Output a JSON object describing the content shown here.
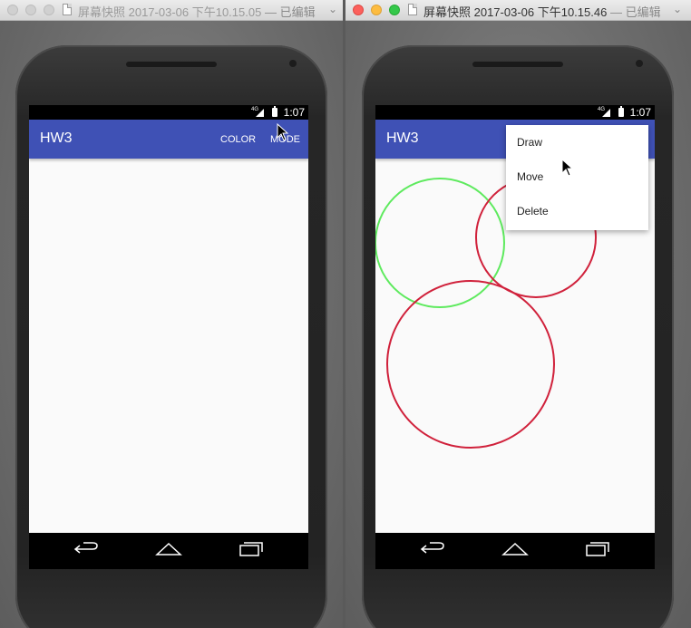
{
  "windows": {
    "left": {
      "title": "屏幕快照 2017-03-06 下午10.15.05",
      "edited_label": "— 已编辑",
      "chevron": "⌄",
      "traffic_lights": "inactive"
    },
    "right": {
      "title": "屏幕快照 2017-03-06 下午10.15.46",
      "edited_label": "— 已编辑",
      "chevron": "⌄",
      "traffic_lights": "active"
    }
  },
  "status_bar": {
    "network": "4G",
    "time": "1:07"
  },
  "app": {
    "title": "HW3",
    "actions": {
      "color": "COLOR",
      "mode": "MODE"
    },
    "accent_color": "#3f51b5"
  },
  "mode_menu": {
    "items": [
      "Draw",
      "Move",
      "Delete"
    ]
  },
  "drawing": {
    "circle_colors": [
      "#5eea5e",
      "#d0213b",
      "#d0213b"
    ]
  },
  "nav_icons": [
    "back-icon",
    "home-icon",
    "recents-icon"
  ]
}
